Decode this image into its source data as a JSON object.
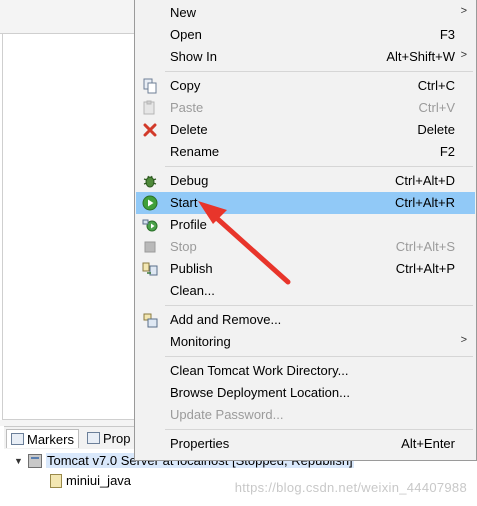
{
  "context_menu": {
    "items": [
      {
        "label": "New",
        "shortcut": "",
        "submenu": true
      },
      {
        "label": "Open",
        "shortcut": "F3"
      },
      {
        "label": "Show In",
        "shortcut": "Alt+Shift+W",
        "submenu": true
      },
      {
        "label": "Copy",
        "shortcut": "Ctrl+C",
        "icon": "copy-icon"
      },
      {
        "label": "Paste",
        "shortcut": "Ctrl+V",
        "icon": "paste-icon",
        "disabled": true
      },
      {
        "label": "Delete",
        "shortcut": "Delete",
        "icon": "delete-icon"
      },
      {
        "label": "Rename",
        "shortcut": "F2"
      },
      {
        "label": "Debug",
        "shortcut": "Ctrl+Alt+D",
        "icon": "debug-icon"
      },
      {
        "label": "Start",
        "shortcut": "Ctrl+Alt+R",
        "icon": "start-icon",
        "highlighted": true
      },
      {
        "label": "Profile",
        "shortcut": "",
        "icon": "profile-icon"
      },
      {
        "label": "Stop",
        "shortcut": "Ctrl+Alt+S",
        "icon": "stop-icon",
        "disabled": true
      },
      {
        "label": "Publish",
        "shortcut": "Ctrl+Alt+P",
        "icon": "publish-icon"
      },
      {
        "label": "Clean...",
        "shortcut": ""
      },
      {
        "label": "Add and Remove...",
        "shortcut": "",
        "icon": "add-remove-icon"
      },
      {
        "label": "Monitoring",
        "shortcut": "",
        "submenu": true
      },
      {
        "label": "Clean Tomcat Work Directory...",
        "shortcut": ""
      },
      {
        "label": "Browse Deployment Location...",
        "shortcut": ""
      },
      {
        "label": "Update Password...",
        "shortcut": "",
        "disabled": true
      },
      {
        "label": "Properties",
        "shortcut": "Alt+Enter"
      }
    ],
    "highlight_color": "#91c9f7",
    "annotation_arrow_color": "#e8352b"
  },
  "views": {
    "tabs": [
      {
        "label": "Markers",
        "icon": "markers-icon"
      },
      {
        "label": "Prop",
        "icon": "properties-icon"
      }
    ]
  },
  "servers_tree": {
    "server_label": "Tomcat v7.0 Server at localhost  [Stopped, Republish]",
    "project_label": "miniui_java"
  },
  "watermark": "https://blog.csdn.net/weixin_44407988"
}
